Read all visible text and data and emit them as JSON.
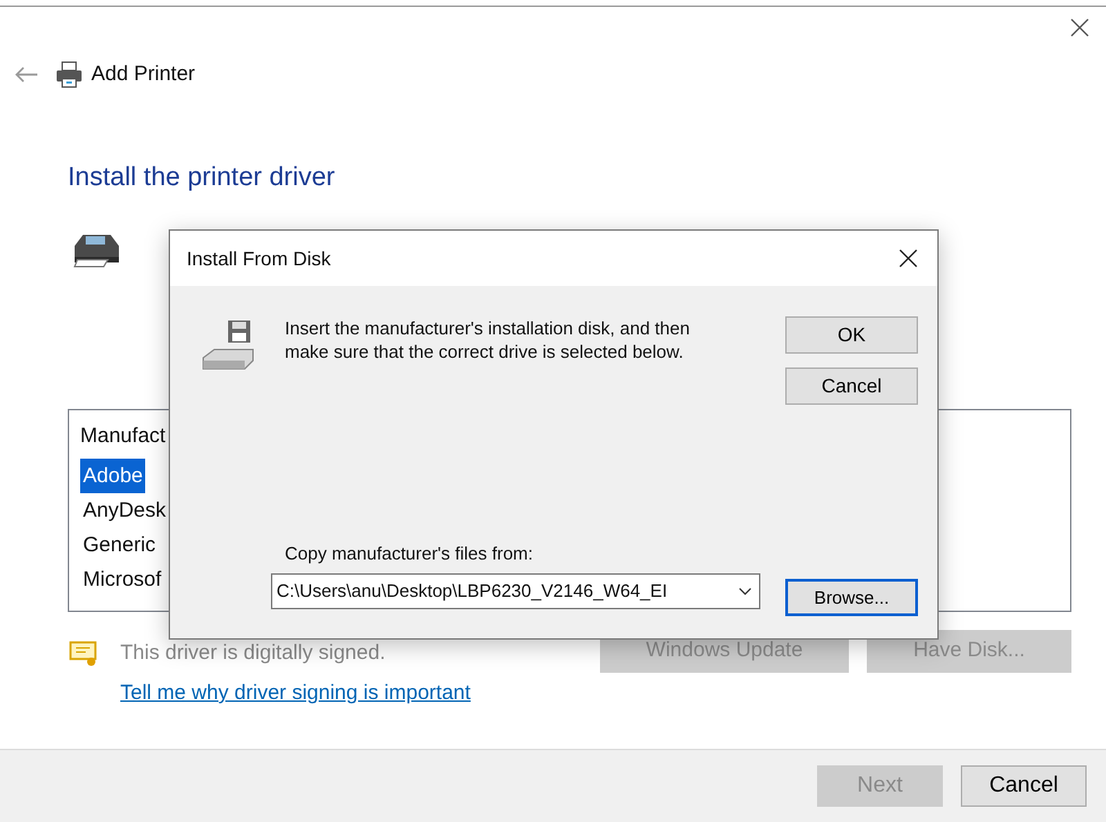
{
  "window": {
    "title": "Add Printer",
    "heading": "Install the printer driver"
  },
  "manufacturer_list": {
    "header": "Manufact",
    "items": [
      {
        "label": "Adobe",
        "selected": true
      },
      {
        "label": "AnyDesk",
        "selected": false
      },
      {
        "label": "Generic",
        "selected": false
      },
      {
        "label": "Microsof",
        "selected": false
      }
    ]
  },
  "list_buttons": [
    {
      "label": "Windows Update",
      "disabled": true
    },
    {
      "label": "Have Disk...",
      "disabled": true
    }
  ],
  "signature": {
    "text": "This driver is digitally signed.",
    "link": "Tell me why driver signing is important"
  },
  "footer_buttons": [
    {
      "label": "Next",
      "disabled": true
    },
    {
      "label": "Cancel",
      "disabled": false
    }
  ],
  "dialog": {
    "title": "Install From Disk",
    "message": "Insert the manufacturer's installation disk, and then make sure that the correct drive is selected below.",
    "buttons": [
      {
        "label": "OK",
        "focused": false
      },
      {
        "label": "Cancel",
        "focused": false
      }
    ],
    "path_label": "Copy manufacturer's files from:",
    "path_value": "C:\\Users\\anu\\Desktop\\LBP6230_V2146_W64_EI",
    "browse": {
      "label": "Browse...",
      "focused": true
    }
  }
}
